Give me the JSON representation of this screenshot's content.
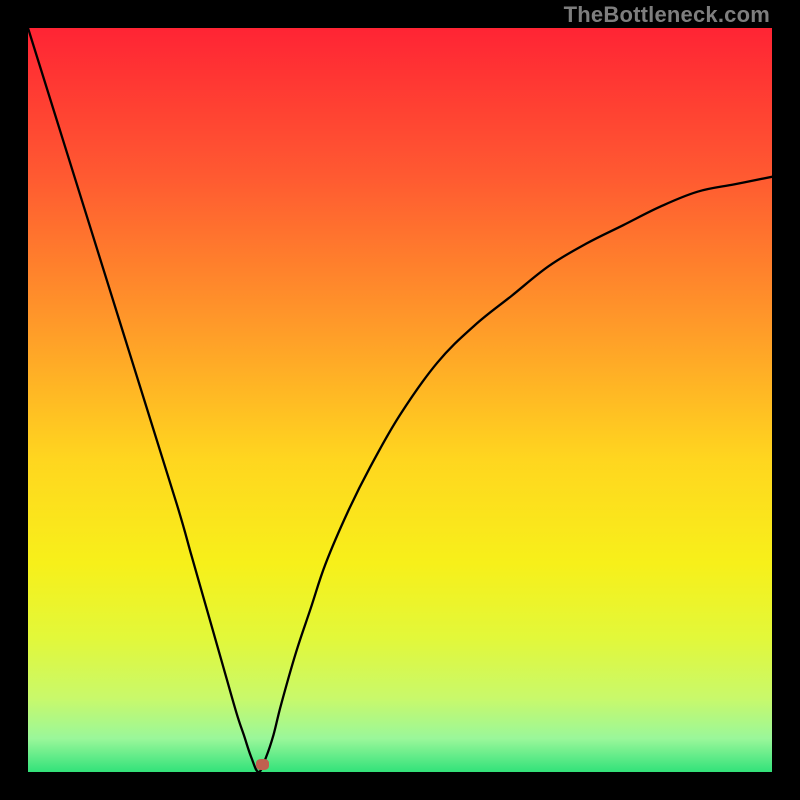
{
  "watermark": "TheBottleneck.com",
  "colors": {
    "black": "#000000",
    "marker": "#c0604f",
    "curve": "#000000",
    "gradient_stops": [
      {
        "offset": 0.0,
        "color": "#ff2434"
      },
      {
        "offset": 0.2,
        "color": "#ff5a31"
      },
      {
        "offset": 0.4,
        "color": "#ff9a29"
      },
      {
        "offset": 0.58,
        "color": "#ffd61f"
      },
      {
        "offset": 0.72,
        "color": "#f7f01a"
      },
      {
        "offset": 0.82,
        "color": "#e2f83a"
      },
      {
        "offset": 0.9,
        "color": "#c9f96a"
      },
      {
        "offset": 0.955,
        "color": "#9af79a"
      },
      {
        "offset": 1.0,
        "color": "#32e27a"
      }
    ]
  },
  "marker": {
    "x_pct": 31.5,
    "y_pct": 99.0
  },
  "chart_data": {
    "type": "line",
    "x": [
      0,
      5,
      10,
      15,
      20,
      22,
      24,
      26,
      28,
      29,
      30,
      31,
      32,
      33,
      34,
      36,
      38,
      40,
      43,
      46,
      50,
      55,
      60,
      65,
      70,
      75,
      80,
      85,
      90,
      95,
      100
    ],
    "series": [
      {
        "name": "bottleneck",
        "values": [
          100,
          84,
          68,
          52,
          36,
          29,
          22,
          15,
          8,
          5,
          2,
          0,
          2,
          5,
          9,
          16,
          22,
          28,
          35,
          41,
          48,
          55,
          60,
          64,
          68,
          71,
          73.5,
          76,
          78,
          79,
          80
        ]
      }
    ],
    "title": "",
    "xlabel": "",
    "ylabel": "",
    "xlim": [
      0,
      100
    ],
    "ylim": [
      0,
      100
    ]
  }
}
